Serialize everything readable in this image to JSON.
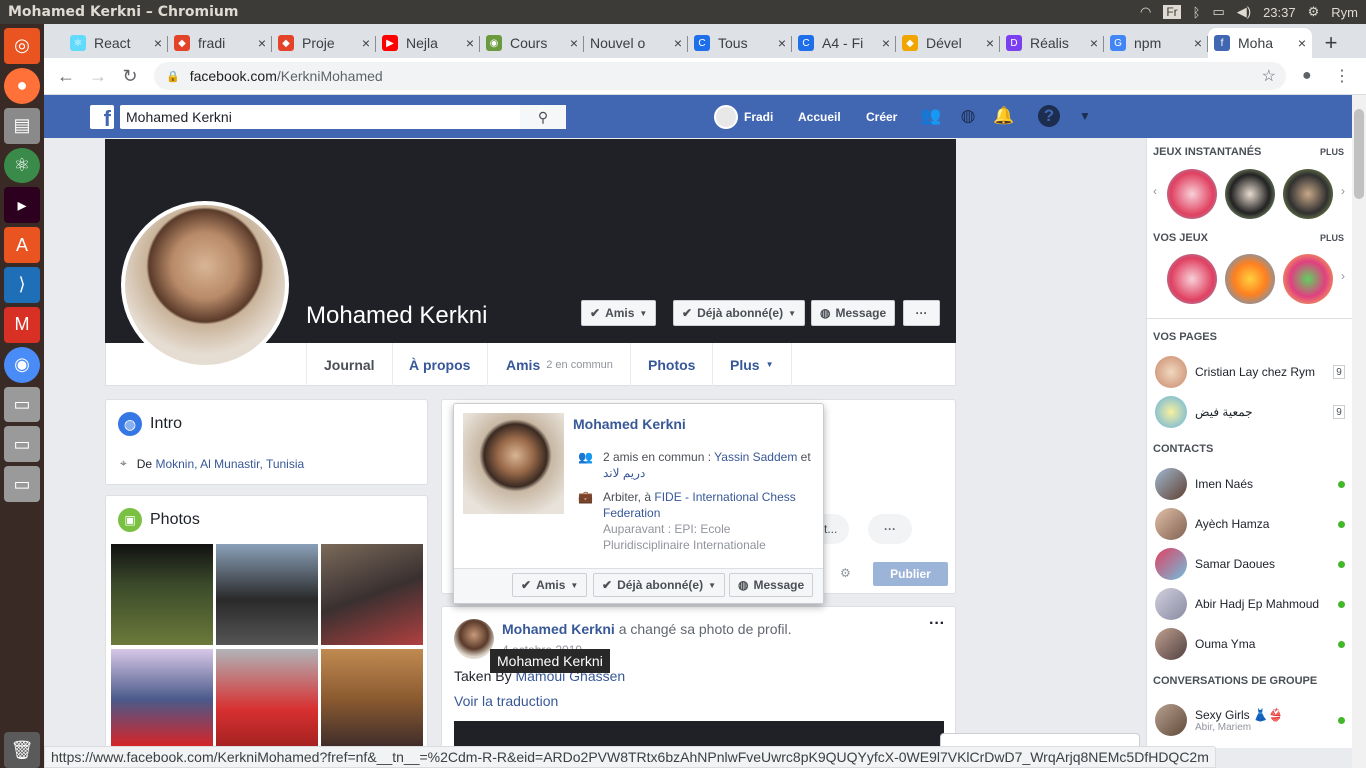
{
  "window": {
    "title": "Mohamed Kerkni – Chromium"
  },
  "system": {
    "lang": "Fr",
    "time": "23:37",
    "user": "Rym"
  },
  "launcher": {
    "items": [
      "dash-icon",
      "firefox-icon",
      "files-icon",
      "atom-icon",
      "terminal-icon",
      "software-icon",
      "vscode-icon",
      "gmail-icon",
      "chromium-icon",
      "drive-icon",
      "drive-icon",
      "drive-icon",
      "trash-icon"
    ]
  },
  "tabs": [
    {
      "label": "React",
      "color": "#61dafb",
      "glyph": "⚛"
    },
    {
      "label": "fradi",
      "color": "#e24329",
      "glyph": "◆"
    },
    {
      "label": "Proje",
      "color": "#e24329",
      "glyph": "◆"
    },
    {
      "label": "Nejla",
      "color": "#ff0000",
      "glyph": "▶"
    },
    {
      "label": "Cours",
      "color": "#6b9a3e",
      "glyph": "◉"
    },
    {
      "label": "Nouvel o",
      "color": "",
      "glyph": ""
    },
    {
      "label": "Tous",
      "color": "#1f6feb",
      "glyph": "C"
    },
    {
      "label": "A4 - Fi",
      "color": "#1f6feb",
      "glyph": "C"
    },
    {
      "label": "Dével",
      "color": "#f0a500",
      "glyph": "◆"
    },
    {
      "label": "Réalis",
      "color": "#7b3ff2",
      "glyph": "D"
    },
    {
      "label": "npm",
      "color": "#4285f4",
      "glyph": "G"
    },
    {
      "label": "Moha",
      "color": "#4267b2",
      "glyph": "f"
    }
  ],
  "address": {
    "host": "facebook.com",
    "path": "/KerkniMohamed"
  },
  "fb": {
    "search_value": "Mohamed Kerkni",
    "user_name": "Fradi",
    "nav_home": "Accueil",
    "nav_create": "Créer",
    "brand_color": "#4267b2"
  },
  "profile": {
    "name": "Mohamed Kerkni",
    "btn_friends": "Amis",
    "btn_following": "Déjà abonné(e)",
    "btn_message": "Message",
    "btn_more": "···",
    "tabs": {
      "journal": "Journal",
      "about": "À propos",
      "friends": "Amis",
      "friends_common": "2 en commun",
      "photos": "Photos",
      "more": "Plus"
    }
  },
  "intro": {
    "title": "Intro",
    "from_prefix": "De",
    "from_place": "Moknin, Al Munastir, Tunisia"
  },
  "photos_card": {
    "title": "Photos"
  },
  "hovercard": {
    "name": "Mohamed Kerkni",
    "mutual": "2 amis en commun :",
    "mutual_friend1": "Yassin Saddem",
    "mutual_and": "et",
    "mutual_friend2": "دريم لاند",
    "work_prefix": "Arbiter, à",
    "work_place": "FIDE - International Chess Federation",
    "previous": "Auparavant : EPI: Ecole Pluridisciplinaire Internationale",
    "btn_friends": "Amis",
    "btn_following": "Déjà abonné(e)",
    "btn_message": "Message"
  },
  "composer": {
    "action_partial": "ct...",
    "more": "···",
    "publish": "Publier"
  },
  "post": {
    "author": "Mohamed Kerkni",
    "action": "a changé sa photo de profil.",
    "date": "4 octobre 2019",
    "text_prefix": "Taken By",
    "text_author": "Mamoui Ghassen",
    "translate": "Voir la traduction",
    "more": "···"
  },
  "tooltip": "Mohamed Kerkni",
  "sidebar": {
    "instant_games": "JEUX INSTANTANÉS",
    "plus1": "PLUS",
    "your_games": "VOS JEUX",
    "plus2": "PLUS",
    "your_pages": "VOS PAGES",
    "pages": [
      {
        "name": "Cristian Lay chez Rym",
        "count": "9"
      },
      {
        "name": "جمعية فيض",
        "count": "9"
      }
    ],
    "contacts_title": "CONTACTS",
    "contacts": [
      {
        "name": "Imen Naés"
      },
      {
        "name": "Ayèch Hamza"
      },
      {
        "name": "Samar Daoues"
      },
      {
        "name": "Abir Hadj Ep Mahmoud"
      },
      {
        "name": "Ouma Yma"
      }
    ],
    "group_title": "CONVERSATIONS DE GROUPE",
    "group_name": "Sexy Girls 👗👙",
    "group_members": "Abir, Mariem"
  },
  "statusbar": "https://www.facebook.com/KerkniMohamed?fref=nf&__tn__=%2Cdm-R-R&eid=ARDo2PVW8TRtx6bzAhNPnlwFveUwrc8pK9QUQYyfcX-0WE9l7VKlCrDwD7_WrqArjq8NEMc5DfHDQC2m"
}
